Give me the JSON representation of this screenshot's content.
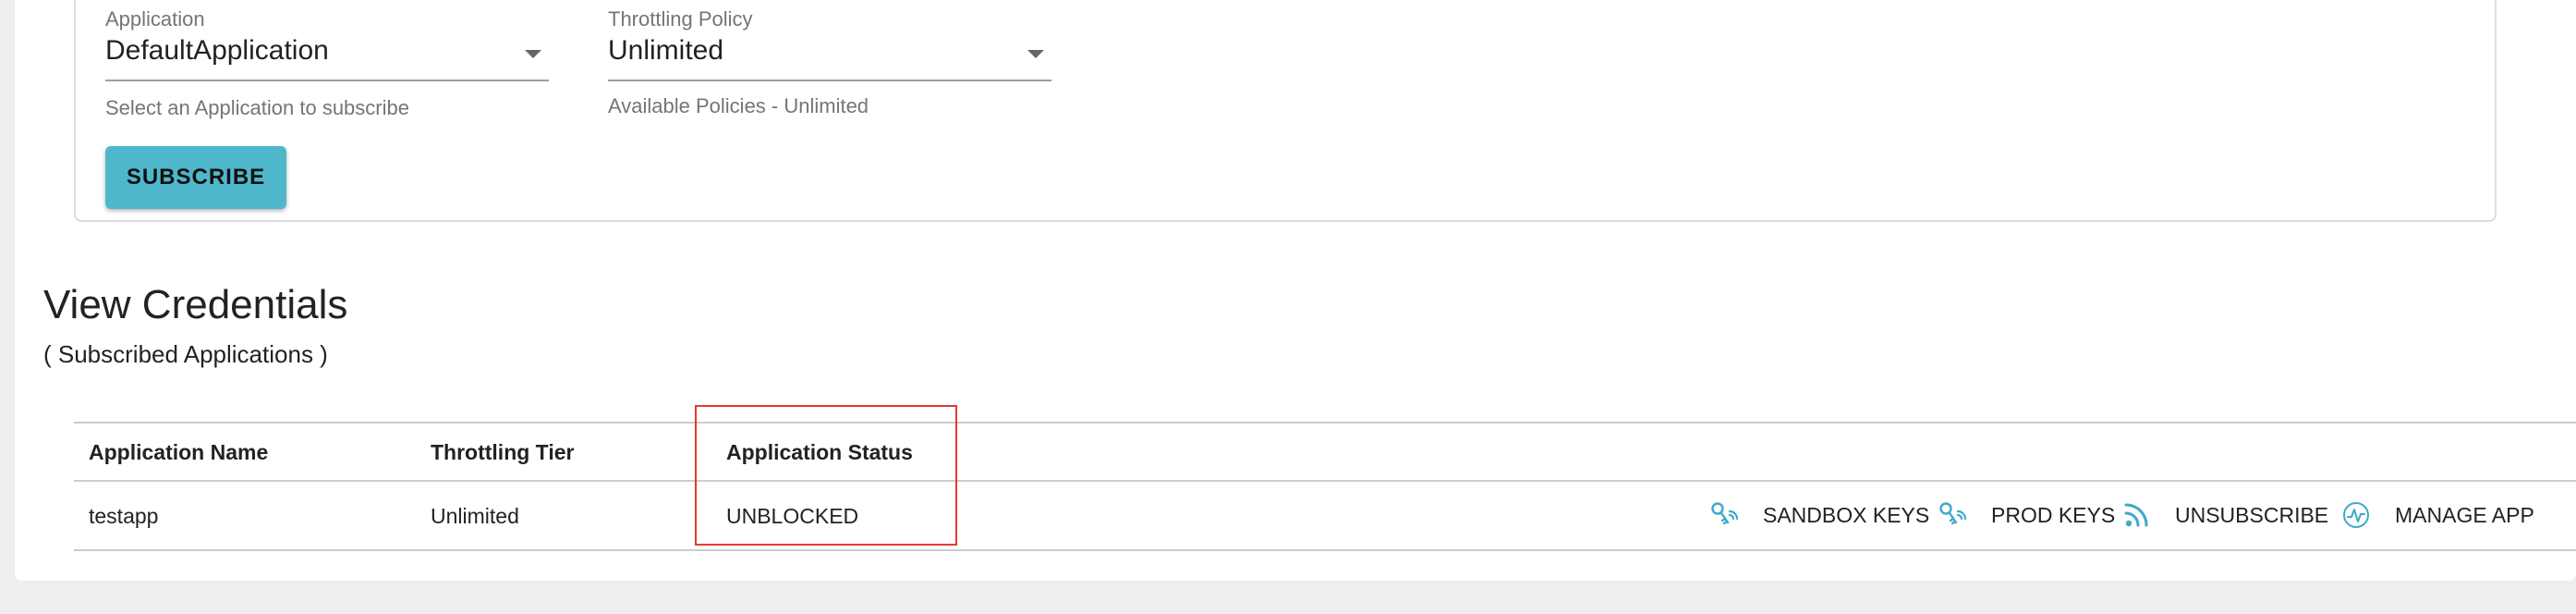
{
  "subscription_form": {
    "application": {
      "label": "Application",
      "value": "DefaultApplication",
      "helper": "Select an Application to subscribe"
    },
    "throttling_policy": {
      "label": "Throttling Policy",
      "value": "Unlimited",
      "helper": "Available Policies - Unlimited"
    },
    "subscribe_label": "SUBSCRIBE"
  },
  "credentials": {
    "title": "View Credentials",
    "subtitle": "( Subscribed Applications )",
    "columns": [
      "Application Name",
      "Throttling Tier",
      "Application Status"
    ],
    "rows": [
      {
        "application_name": "testapp",
        "throttling_tier": "Unlimited",
        "application_status": "UNBLOCKED",
        "actions": [
          {
            "label": "SANDBOX KEYS",
            "icon": "key-icon"
          },
          {
            "label": "PROD KEYS",
            "icon": "key-icon"
          },
          {
            "label": "UNSUBSCRIBE",
            "icon": "rss-icon"
          },
          {
            "label": "MANAGE APP",
            "icon": "activity-circle-icon"
          }
        ]
      }
    ]
  },
  "colors": {
    "accent": "#4fb7cc",
    "icon": "#3fa9c9",
    "highlight": "#e53935"
  }
}
